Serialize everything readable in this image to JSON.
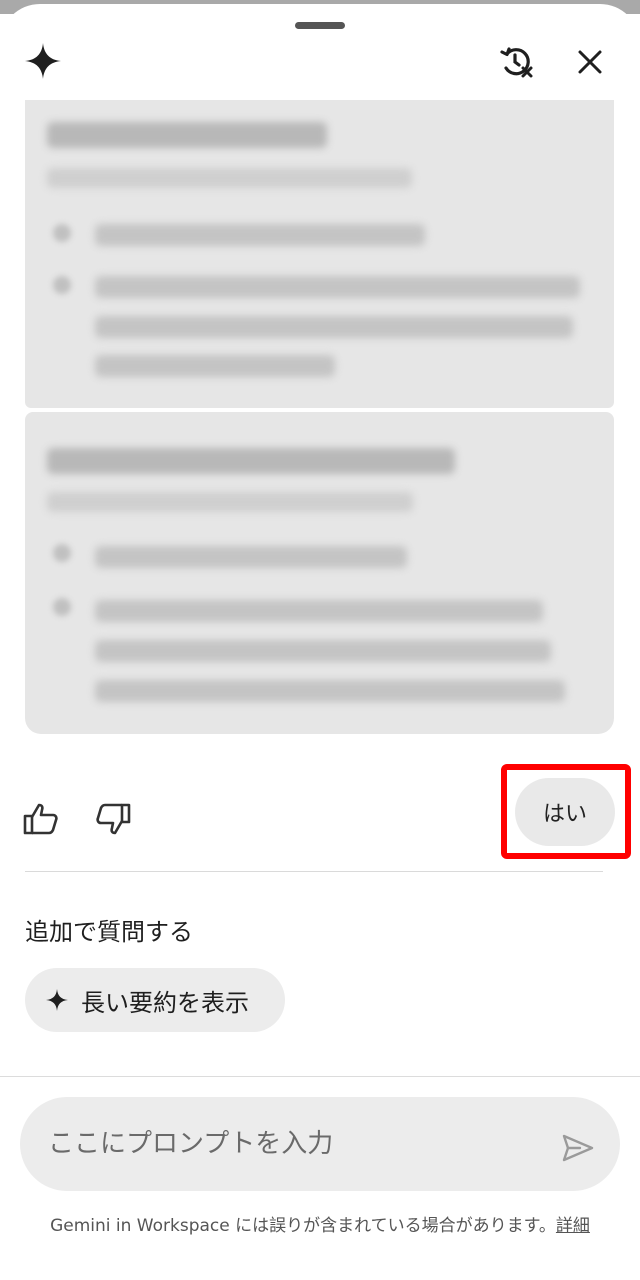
{
  "header": {
    "logo_icon": "gemini-sparkle-icon",
    "history_icon": "history-clear-icon",
    "close_icon": "close-icon"
  },
  "feedback": {
    "thumbs_up_icon": "thumbs-up-icon",
    "thumbs_down_icon": "thumbs-down-icon",
    "yes_label": "はい"
  },
  "followup": {
    "heading": "追加で質問する",
    "chip_icon": "sparkle-icon",
    "chip_label": "長い要約を表示"
  },
  "prompt": {
    "placeholder": "ここにプロンプトを入力",
    "send_icon": "send-icon"
  },
  "footer": {
    "disclaimer": "Gemini in Workspace には誤りが含まれている場合があります。",
    "link_label": "詳細"
  },
  "colors": {
    "highlight": "#ff0000",
    "card_bg": "#e6e6e6",
    "chip_bg": "#ececec"
  }
}
